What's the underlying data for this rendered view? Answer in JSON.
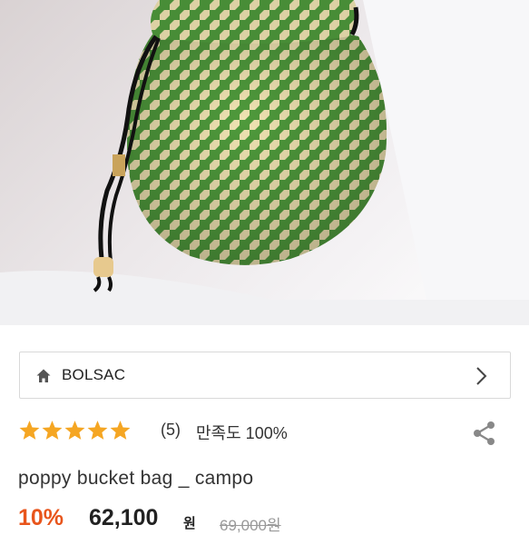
{
  "product_image": {
    "icon": "product-photo",
    "description_colors": {
      "green": "#4f9a3c",
      "cream": "#efe3b2"
    }
  },
  "brand": {
    "name": "BOLSAC",
    "home_icon": "home-icon",
    "arrow_icon": "chevron-right-icon"
  },
  "rating": {
    "stars": 5,
    "star_color": "#f5a623",
    "review_count": "(5)",
    "satisfaction": "만족도 100%",
    "share_icon": "share-icon"
  },
  "product": {
    "name": "poppy bucket bag _ campo"
  },
  "pricing": {
    "discount": "10%",
    "discount_color": "#e8551c",
    "price": "62,100",
    "unit": "원",
    "original_price": "69,000원"
  }
}
